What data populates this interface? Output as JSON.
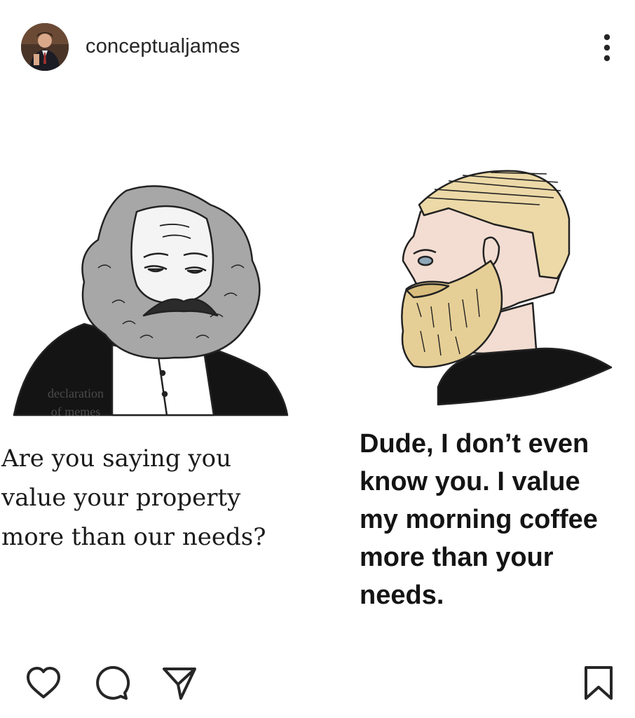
{
  "post": {
    "username": "conceptualjames",
    "image": {
      "watermark": "declaration\nof memes",
      "left_caption": "Are you saying you\nvalue your property\nmore than our needs?",
      "right_caption": "Dude, I don’t even\nknow you.  I value\nmy morning coffee\nmore than your\nneeds."
    }
  },
  "icons": {
    "avatar": "profile-photo",
    "more": "more-options-icon",
    "like": "heart-icon",
    "comment": "comment-icon",
    "share": "send-icon",
    "save": "bookmark-icon"
  },
  "colors": {
    "text": "#262626",
    "background": "#ffffff",
    "icon": "#262626"
  }
}
